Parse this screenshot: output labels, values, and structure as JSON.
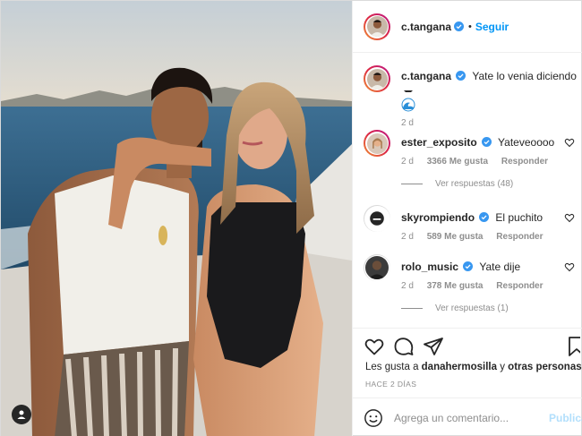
{
  "post": {
    "author": {
      "username": "c.tangana",
      "verified": true,
      "avatar_icon": "profile-photo"
    },
    "follow_label": "Seguir",
    "caption": {
      "username": "c.tangana",
      "text": "Yate lo venia diciendo",
      "time": "2 d"
    },
    "comments": [
      {
        "username": "ester_exposito",
        "verified": true,
        "text": "Yateveoooo",
        "time": "2 d",
        "likes": "3366 Me gusta",
        "reply_label": "Responder",
        "replies_label": "Ver respuestas (48)"
      },
      {
        "username": "skyrompiendo",
        "verified": true,
        "text": "El puchito",
        "time": "2 d",
        "likes": "589 Me gusta",
        "reply_label": "Responder"
      },
      {
        "username": "rolo_music",
        "verified": true,
        "text": "Yate dije",
        "time": "2 d",
        "likes": "378 Me gusta",
        "reply_label": "Responder",
        "replies_label": "Ver respuestas (1)"
      }
    ],
    "actions": {
      "icons": [
        "heart-icon",
        "comment-icon",
        "share-icon",
        "bookmark-icon"
      ]
    },
    "liked_by": {
      "prefix": "Les gusta a ",
      "user": "danahermosilla",
      "joiner": " y ",
      "others": "otras personas"
    },
    "timestamp": "HACE 2 DÍAS",
    "add_comment": {
      "placeholder": "Agrega un comentario...",
      "publish_label": "Publicar"
    }
  },
  "colors": {
    "accent": "#0095f6",
    "verified": "#3897f0",
    "muted": "#8e8e8e",
    "publish_disabled": "#b2dffc"
  }
}
